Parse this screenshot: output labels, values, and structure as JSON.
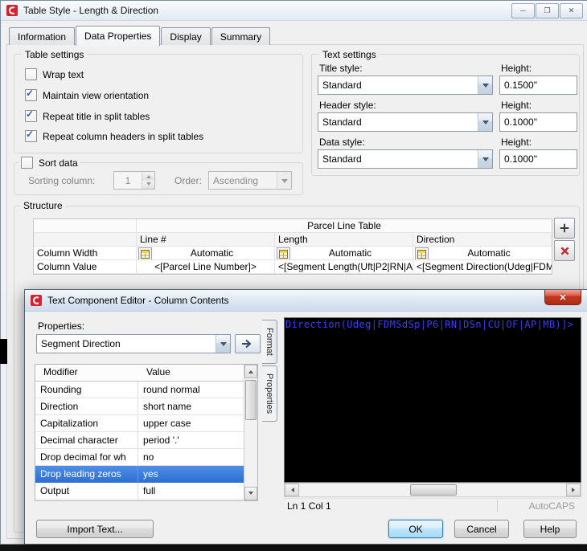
{
  "icons": {
    "minimize": "─",
    "maximize": "❐",
    "close": "✕"
  },
  "main_dialog": {
    "title": "Table Style - Length & Direction",
    "tabs": [
      {
        "label": "Information",
        "active": false
      },
      {
        "label": "Data Properties",
        "active": true
      },
      {
        "label": "Display",
        "active": false
      },
      {
        "label": "Summary",
        "active": false
      }
    ],
    "table_settings": {
      "title": "Table settings",
      "options": [
        {
          "label": "Wrap text",
          "checked": false
        },
        {
          "label": "Maintain view orientation",
          "checked": true
        },
        {
          "label": "Repeat title in split tables",
          "checked": true
        },
        {
          "label": "Repeat column headers in split tables",
          "checked": true
        }
      ]
    },
    "sort_data": {
      "title": "Sort data",
      "checked": false,
      "sorting_column_label": "Sorting column:",
      "sorting_column_value": "1",
      "order_label": "Order:",
      "order_value": "Ascending"
    },
    "text_settings": {
      "title": "Text settings",
      "height_label": "Height:",
      "rows": [
        {
          "label": "Title style:",
          "style": "Standard",
          "height": "0.1500\""
        },
        {
          "label": "Header style:",
          "style": "Standard",
          "height": "0.1000\""
        },
        {
          "label": "Data style:",
          "style": "Standard",
          "height": "0.1000\""
        }
      ]
    },
    "structure": {
      "title": "Structure",
      "table_title": "Parcel Line Table",
      "columns": [
        "Line #",
        "Length",
        "Direction"
      ],
      "width_row": {
        "label": "Column Width",
        "values": [
          "Automatic",
          "Automatic",
          "Automatic"
        ]
      },
      "value_row": {
        "label": "Column Value",
        "values": [
          "<[Parcel Line Number]>",
          "<[Segment Length(Uft|P2|RN|A...",
          "<[Segment Direction(Udeg|FDM..."
        ]
      }
    }
  },
  "editor_dialog": {
    "title": "Text Component Editor - Column Contents",
    "properties_label": "Properties:",
    "properties_value": "Segment Direction",
    "side_tabs": [
      {
        "label": "Format",
        "active": false
      },
      {
        "label": "Properties",
        "active": true
      }
    ],
    "modifier_table": {
      "headers": [
        "Modifier",
        "Value"
      ],
      "rows": [
        {
          "modifier": "Rounding",
          "value": "round normal",
          "selected": false
        },
        {
          "modifier": "Direction",
          "value": "short name",
          "selected": false
        },
        {
          "modifier": "Capitalization",
          "value": "upper case",
          "selected": false
        },
        {
          "modifier": "Decimal character",
          "value": "period '.'",
          "selected": false
        },
        {
          "modifier": "Drop decimal for wh",
          "value": "no",
          "selected": false
        },
        {
          "modifier": "Drop leading zeros",
          "value": "yes",
          "selected": true
        },
        {
          "modifier": "Output",
          "value": "full",
          "selected": false
        }
      ]
    },
    "editor_text": "Direction(Udeg|FDMSdSp|P6|RN|DSn|CU|OF|AP|MB)]>",
    "status": {
      "position": "Ln 1 Col 1",
      "autocaps": "AutoCAPS"
    },
    "buttons": {
      "import": "Import Text...",
      "ok": "OK",
      "cancel": "Cancel",
      "help": "Help"
    }
  },
  "colors": {
    "selection": "#3d7edb",
    "editor_background": "#000000",
    "editor_text": "#3a3aff",
    "close_button": "#c13428"
  }
}
